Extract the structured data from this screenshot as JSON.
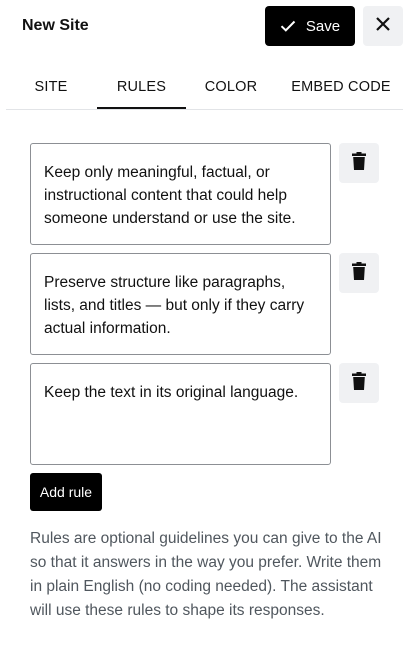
{
  "header": {
    "title": "New Site",
    "save_label": "Save",
    "save_icon": "check-icon",
    "close_icon": "close-icon"
  },
  "tabs": [
    {
      "label": "SITE",
      "active": false
    },
    {
      "label": "RULES",
      "active": true
    },
    {
      "label": "COLOR",
      "active": false
    },
    {
      "label": "EMBED CODE",
      "active": false
    }
  ],
  "rules": [
    {
      "text": "Keep only meaningful, factual, or instructional content that could help someone understand or use the site.",
      "delete_icon": "trash-icon"
    },
    {
      "text": "Preserve structure like paragraphs, lists, and titles — but only if they carry actual information.",
      "delete_icon": "trash-icon"
    },
    {
      "text": "Keep the text in its original language.",
      "delete_icon": "trash-icon"
    }
  ],
  "add_rule_label": "Add rule",
  "help_text": "Rules are optional guidelines you can give to the AI so that it answers in the way you prefer. Write them in plain English (no coding needed). The assistant will use these rules to shape its responses.",
  "colors": {
    "primary_button": "#000000",
    "icon_button_bg": "#f0f1f3",
    "help_text": "#50575e",
    "border": "#8c8f94"
  }
}
